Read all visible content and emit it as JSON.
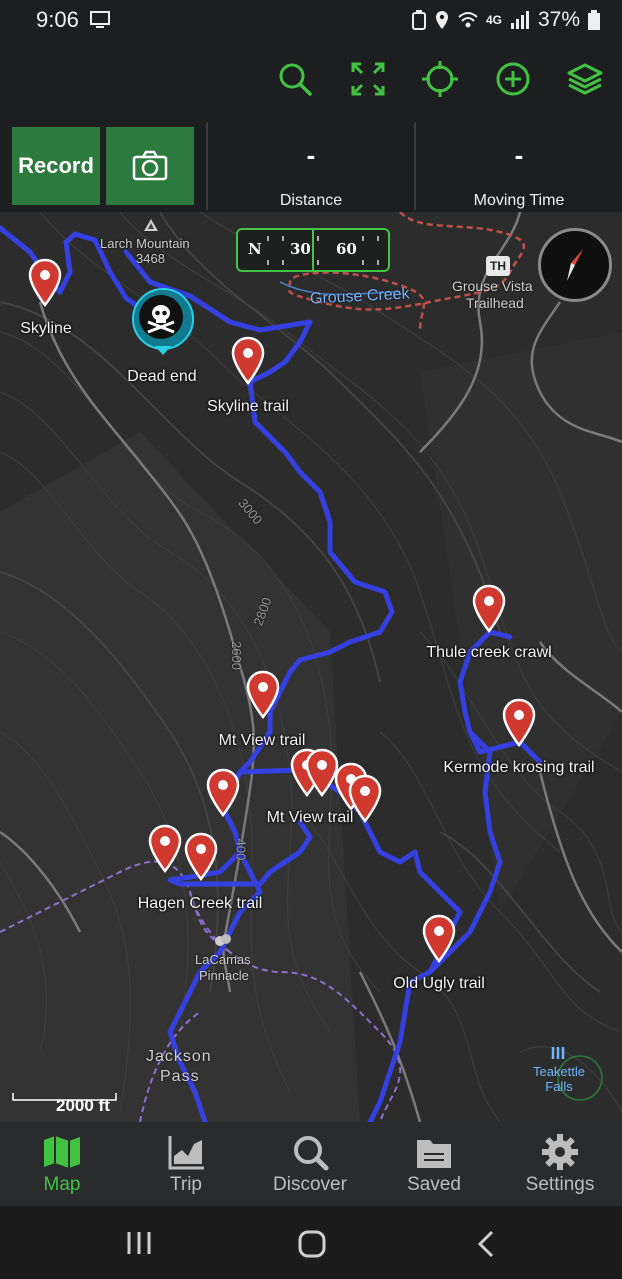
{
  "status_bar": {
    "time": "9:06",
    "network": "4G",
    "battery": "37%"
  },
  "toolbar": {
    "icons": [
      "search-icon",
      "fullscreen-icon",
      "locate-icon",
      "add-icon",
      "layers-icon"
    ],
    "accent_color": "#41c241"
  },
  "panel": {
    "record_label": "Record",
    "camera_icon": "camera-icon",
    "distance_value": "-",
    "distance_label": "Distance",
    "moving_time_value": "-",
    "moving_time_label": "Moving Time"
  },
  "map": {
    "compass_bar": {
      "n": "N",
      "t30": "30",
      "t60": "60"
    },
    "places": {
      "larch_mountain": "Larch Mountain",
      "larch_elev": "3468",
      "grouse_creek": "Grouse Creek",
      "grouse_vista": "Grouse Vista",
      "trailhead": "Trailhead",
      "th_badge": "TH",
      "lacamas": "LaCamas",
      "pinnacle": "Pinnacle",
      "jackson": "Jackson",
      "pass": "Pass",
      "teakettle": "Teakettle",
      "falls": "Falls",
      "contour_3000": "3000",
      "contour_2800": "2800",
      "contour_2600": "2600",
      "contour_400": "400"
    },
    "pin_labels": {
      "skyline": "Skyline",
      "dead_end": "Dead end",
      "skyline_trail": "Skyline trail",
      "thule": "Thule creek crawl",
      "mt_view_1": "Mt View trail",
      "kermode": "Kermode krosing trail",
      "mt_view_2": "Mt View trail",
      "hagen": "Hagen Creek trail",
      "old_ugly": "Old Ugly trail"
    },
    "scale": "2000 ft",
    "trail_color": "#3540e0",
    "pin_color": "#d0392f"
  },
  "bottom_nav": {
    "items": [
      {
        "label": "Map",
        "icon": "map-icon",
        "active": true
      },
      {
        "label": "Trip",
        "icon": "chart-icon",
        "active": false
      },
      {
        "label": "Discover",
        "icon": "discover-icon",
        "active": false
      },
      {
        "label": "Saved",
        "icon": "folder-icon",
        "active": false
      },
      {
        "label": "Settings",
        "icon": "gear-icon",
        "active": false
      }
    ]
  }
}
